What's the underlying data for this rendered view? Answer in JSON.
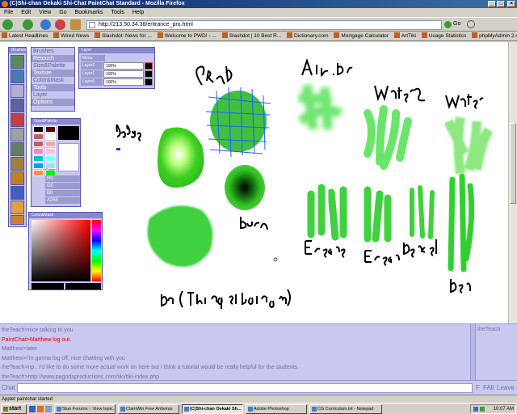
{
  "window": {
    "title": "(C)Shi-chan Oekaki Shi-Chat PaintChat Standard - Mozilla Firefox"
  },
  "menu": [
    "File",
    "Edit",
    "View",
    "Go",
    "Bookmarks",
    "Tools",
    "Help"
  ],
  "navigation": {
    "url": "http://213.50.34.38/entrance_pro.html",
    "go_label": "Go"
  },
  "bookmarks": [
    "Latest Headlines",
    "Wired News",
    "Slashdot: News for ...",
    "Welcome to PWD! - ...",
    "Slashdot | 10 Best R...",
    "Dictionary.com",
    "Mortgage Calculator",
    "ArtTiki",
    "Usage Statistics",
    "phpMyAdmin 2.4.0"
  ],
  "brushes_panel": {
    "title": "Brushes",
    "items": [
      "Brushes",
      "Retouch",
      "Size&Palette",
      "Texture",
      "Color&Mask",
      "Tools",
      "Layer",
      "Options"
    ]
  },
  "layer_panel": {
    "title": "Layer",
    "menu_label": "Menu",
    "layers": [
      {
        "name": "Layer2",
        "opacity": "100%"
      },
      {
        "name": "Layer1",
        "opacity": "100%"
      },
      {
        "name": "Layer0",
        "opacity": "100%"
      }
    ]
  },
  "size_palette_panel": {
    "title": "Size&Palette",
    "swatches": [
      "#000000",
      "#500000",
      "#c06060",
      "#ffffff",
      "#c06060",
      "#ffa0a0",
      "#ff80c0",
      "#ffc0e0",
      "#00c0c0",
      "#80ffff",
      "#00a0ff",
      "#a0e0ff",
      "#ff9040",
      "#00ff00"
    ],
    "color_label": "Color",
    "r": "R0",
    "g": "G0",
    "b": "B0",
    "a": "A255"
  },
  "mask_panel": {
    "title": "Color&Mask"
  },
  "canvas_labels": {
    "grad": "Grad",
    "airbr": "Air.Br",
    "water2": "Water2",
    "water": "Water",
    "dodge": "dodge",
    "burn": "Burn",
    "eraser2": "Eraser2",
    "eraser": "Eraser",
    "pencil": "Pencil",
    "pen": "Pen",
    "bottom": "Pen (Thing at bottom)"
  },
  "chat": {
    "lines": [
      {
        "text": "theTeach>nice talking to you",
        "system": false
      },
      {
        "text": "PaintChat>Matthew log out.",
        "system": true
      },
      {
        "text": "Matthew>later",
        "system": false
      },
      {
        "text": "Matthew>I'm gonna log off, nice chatting with you",
        "system": false
      },
      {
        "text": "theTeach>np.. I'd like to do some more actual work on here but I think a tutorial would be really helpful for the students",
        "system": false
      },
      {
        "text": "theTeach>http://www.pagodaproductions.com/tiki/tiki-index.php",
        "system": false
      }
    ],
    "users": [
      "theTeach"
    ],
    "input_label": "Chat",
    "buttons": {
      "f": "F",
      "fall": "FAll",
      "leave": "Leave"
    }
  },
  "status": "Applet paintchat started",
  "taskbar": {
    "start_label": "start",
    "items": [
      {
        "label": "Stun Forums :: View topic...",
        "active": false
      },
      {
        "label": "ClamWin Free Antivirus",
        "active": false
      },
      {
        "label": "(C)Shi-chan Oekaki Sh...",
        "active": true
      },
      {
        "label": "Adobe Photoshop",
        "active": false
      },
      {
        "label": "CG Curriculum.txt - Notepad",
        "active": false
      }
    ],
    "clock": "10:07 AM"
  }
}
